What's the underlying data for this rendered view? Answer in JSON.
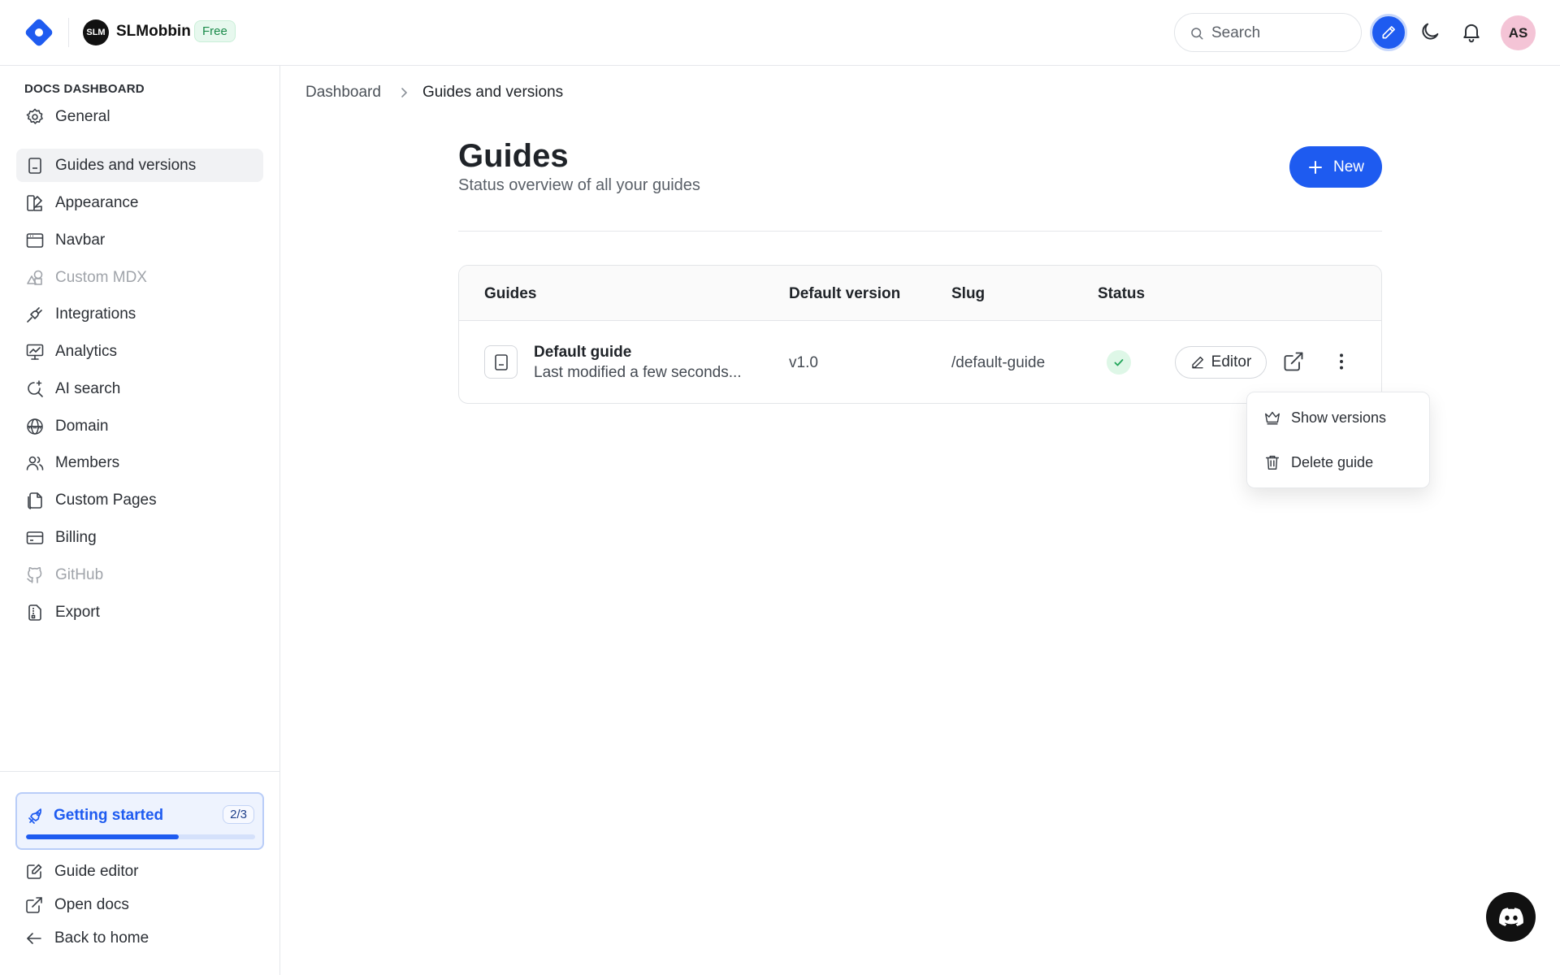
{
  "header": {
    "org_initials": "SLM",
    "org_name": "SLMobbin",
    "plan_badge": "Free",
    "search_placeholder": "Search",
    "user_initials": "AS"
  },
  "sidebar": {
    "heading": "DOCS DASHBOARD",
    "items": [
      {
        "label": "General",
        "icon": "gear-icon",
        "state": "normal"
      },
      {
        "label": "Guides and versions",
        "icon": "book-icon",
        "state": "active"
      },
      {
        "label": "Appearance",
        "icon": "palette-icon",
        "state": "normal"
      },
      {
        "label": "Navbar",
        "icon": "navbar-icon",
        "state": "normal"
      },
      {
        "label": "Custom MDX",
        "icon": "shapes-icon",
        "state": "disabled"
      },
      {
        "label": "Integrations",
        "icon": "plug-icon",
        "state": "normal"
      },
      {
        "label": "Analytics",
        "icon": "monitor-chart-icon",
        "state": "normal"
      },
      {
        "label": "AI search",
        "icon": "ai-search-icon",
        "state": "normal"
      },
      {
        "label": "Domain",
        "icon": "globe-icon",
        "state": "normal"
      },
      {
        "label": "Members",
        "icon": "users-icon",
        "state": "normal"
      },
      {
        "label": "Custom Pages",
        "icon": "files-icon",
        "state": "normal"
      },
      {
        "label": "Billing",
        "icon": "credit-card-icon",
        "state": "normal"
      },
      {
        "label": "GitHub",
        "icon": "github-icon",
        "state": "disabled"
      },
      {
        "label": "Export",
        "icon": "file-export-icon",
        "state": "normal"
      }
    ],
    "getting_started": {
      "label": "Getting started",
      "count": "2/3",
      "progress": 0.667
    },
    "footer": {
      "guide_editor": "Guide editor",
      "open_docs": "Open docs",
      "back_home": "Back to home"
    }
  },
  "breadcrumb": {
    "root": "Dashboard",
    "current": "Guides and versions"
  },
  "page": {
    "title": "Guides",
    "subtitle": "Status overview of all your guides",
    "new_button": "New"
  },
  "table": {
    "headers": {
      "guides": "Guides",
      "default_version": "Default version",
      "slug": "Slug",
      "status": "Status"
    },
    "rows": [
      {
        "name": "Default guide",
        "modified": "Last modified a few seconds...",
        "version": "v1.0",
        "slug": "/default-guide",
        "status": "published",
        "editor_label": "Editor"
      }
    ]
  },
  "row_menu": {
    "show_versions": "Show versions",
    "delete_guide": "Delete guide"
  },
  "colors": {
    "accent": "#1e5bf0",
    "success": "#22a55a",
    "free_badge_bg": "#e7f8ee"
  }
}
